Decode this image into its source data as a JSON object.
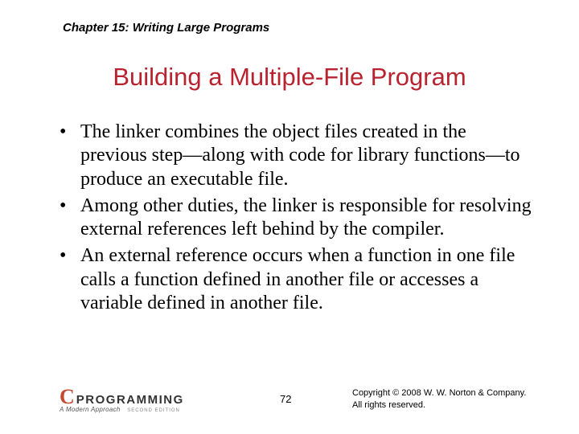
{
  "chapter": "Chapter 15: Writing Large Programs",
  "title": "Building a Multiple-File Program",
  "bullets": [
    "The linker combines the object files created in the previous step—along with code for library functions—to produce an executable file.",
    "Among other duties, the linker is responsible for resolving external references left behind by the compiler.",
    "An external reference occurs when a function in one file calls a function defined in another file or accesses a variable defined in another file."
  ],
  "logo": {
    "c": "C",
    "word": "PROGRAMMING",
    "sub": "A Modern Approach",
    "edition": "SECOND EDITION"
  },
  "page": "72",
  "copyright_line1": "Copyright © 2008 W. W. Norton & Company.",
  "copyright_line2": "All rights reserved."
}
